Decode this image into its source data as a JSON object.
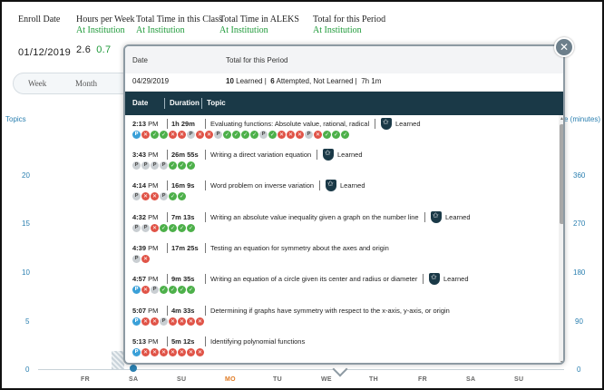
{
  "header": {
    "enroll_date_label": "Enroll Date",
    "enroll_date_value": "01/12/2019",
    "hours_per_week_label": "Hours per Week",
    "hours_per_week_sub": "At Institution",
    "hours_per_week_value": "2.6",
    "hours_per_week_inst": "0.7",
    "total_time_class_label": "Total Time in this Class",
    "total_time_class_sub": "At Institution",
    "total_time_aleks_label": "Total Time in ALEKS",
    "total_time_aleks_sub": "At Institution",
    "total_period_label": "Total for this Period",
    "total_period_sub": "At Institution"
  },
  "toggle": {
    "week": "Week",
    "month": "Month"
  },
  "chart": {
    "left_axis_label": "Topics",
    "right_axis_label": "e (minutes)",
    "left_ticks": [
      "20",
      "15",
      "10",
      "5",
      "0"
    ],
    "right_ticks": [
      "360",
      "270",
      "180",
      "90",
      "0"
    ],
    "x_ticks": [
      "FR",
      "SA",
      "SU",
      "MO",
      "TU",
      "WE",
      "TH",
      "FR",
      "SA",
      "SU"
    ],
    "highlight_color": "#e07b24",
    "axis_color": "#2a7fb0"
  },
  "popup": {
    "date_label": "Date",
    "total_label": "Total for this Period",
    "date_value": "04/29/2019",
    "learned_count": "10",
    "learned_text": "Learned",
    "attempted_count": "6",
    "attempted_text": "Attempted, Not Learned",
    "total_time": "7h 1m",
    "col_date": "Date",
    "col_duration": "Duration",
    "col_topic": "Topic",
    "learned_badge": "Learned",
    "close_icon": "close-icon",
    "entries": [
      {
        "time": "2:13",
        "ampm": "PM",
        "dur_a": "1h",
        "dur_b": "29m",
        "topic": "Evaluating functions: Absolute value, rational, radical",
        "learned": true,
        "dots": [
          "pb",
          "x",
          "c",
          "c",
          "x",
          "x",
          "p",
          "x",
          "x",
          "p",
          "c",
          "c",
          "c",
          "c",
          "p",
          "c",
          "x",
          "x",
          "x",
          "p",
          "x",
          "c",
          "c",
          "c"
        ]
      },
      {
        "time": "3:43",
        "ampm": "PM",
        "dur_a": "26m",
        "dur_b": "55s",
        "topic": "Writing a direct variation equation",
        "learned": true,
        "dots": [
          "p",
          "p",
          "p",
          "p",
          "c",
          "c",
          "c"
        ]
      },
      {
        "time": "4:14",
        "ampm": "PM",
        "dur_a": "16m",
        "dur_b": "9s",
        "topic": "Word problem on inverse variation",
        "learned": true,
        "dots": [
          "p",
          "x",
          "x",
          "p",
          "c",
          "c"
        ]
      },
      {
        "time": "4:32",
        "ampm": "PM",
        "dur_a": "7m",
        "dur_b": "13s",
        "topic": "Writing an absolute value inequality given a graph on the number line",
        "learned": true,
        "dots": [
          "p",
          "p",
          "x",
          "c",
          "c",
          "c",
          "c"
        ]
      },
      {
        "time": "4:39",
        "ampm": "PM",
        "dur_a": "17m",
        "dur_b": "25s",
        "topic": "Testing an equation for symmetry about the axes and origin",
        "learned": false,
        "dots": [
          "p",
          "x"
        ]
      },
      {
        "time": "4:57",
        "ampm": "PM",
        "dur_a": "9m",
        "dur_b": "35s",
        "topic": "Writing an equation of a circle given its center and radius or diameter",
        "learned": true,
        "dots": [
          "pb",
          "x",
          "p",
          "c",
          "c",
          "c",
          "c"
        ]
      },
      {
        "time": "5:07",
        "ampm": "PM",
        "dur_a": "4m",
        "dur_b": "33s",
        "topic": "Determining if graphs have symmetry with respect to the x-axis, y-axis, or origin",
        "learned": false,
        "dots": [
          "pb",
          "x",
          "x",
          "p",
          "x",
          "x",
          "x",
          "x"
        ]
      },
      {
        "time": "5:13",
        "ampm": "PM",
        "dur_a": "5m",
        "dur_b": "12s",
        "topic": "Identifying polynomial functions",
        "learned": false,
        "dots": [
          "pb",
          "x",
          "x",
          "x",
          "x",
          "x",
          "x",
          "x"
        ]
      }
    ]
  }
}
